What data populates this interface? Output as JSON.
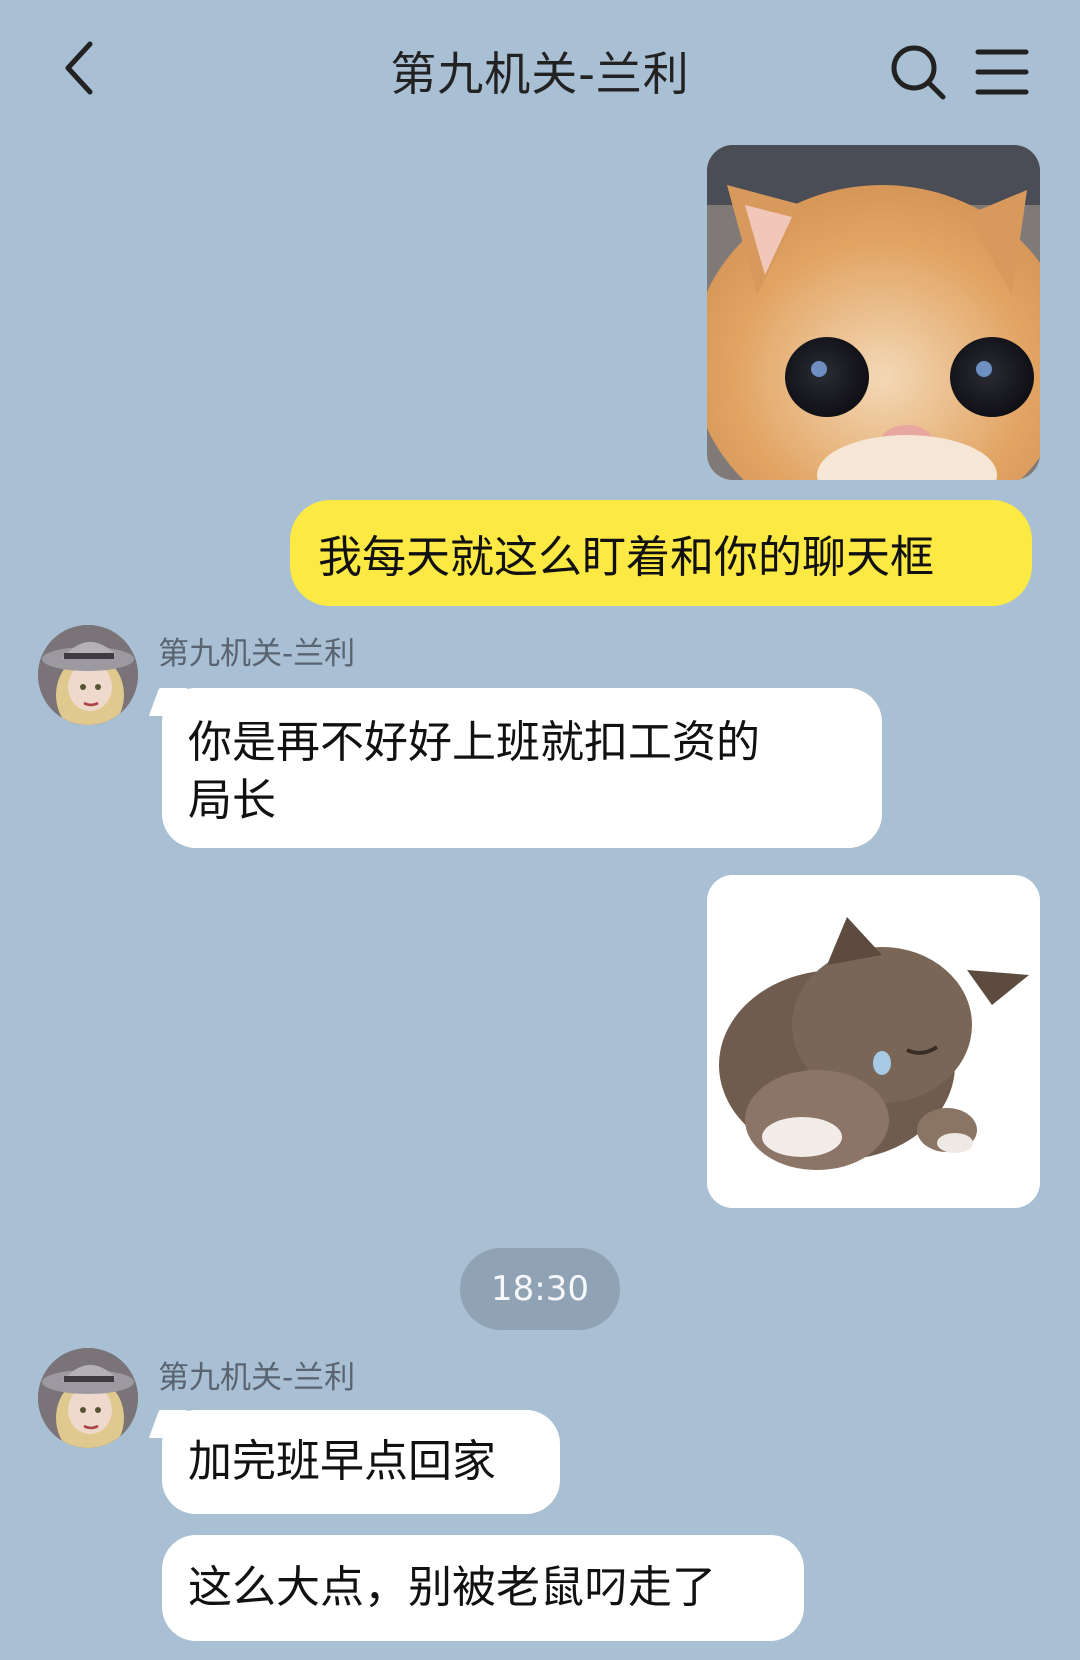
{
  "header": {
    "title": "第九机关-兰利",
    "back_icon": "chevron-left-icon",
    "search_icon": "search-icon",
    "menu_icon": "menu-icon"
  },
  "messages": [
    {
      "side": "sent",
      "type": "image",
      "icon": "kitten-sticker"
    },
    {
      "side": "sent",
      "type": "text",
      "text": "我每天就这么盯着和你的聊天框"
    },
    {
      "side": "received",
      "sender": "第九机关-兰利",
      "type": "text",
      "lines": [
        "你是再不好好上班就扣工资的",
        "局长"
      ]
    },
    {
      "side": "sent",
      "type": "image",
      "icon": "kitten-sticker"
    },
    {
      "type": "time",
      "text": "18:30"
    },
    {
      "side": "received",
      "sender": "第九机关-兰利",
      "type": "text",
      "text": "加完班早点回家"
    },
    {
      "side": "received",
      "type": "text",
      "text": "这么大点，别被老鼠叼走了"
    }
  ],
  "colors": {
    "background": "#a9bfd3",
    "sent_bubble": "#fde943",
    "received_bubble": "#ffffff",
    "time_pill": "#8fa3b5"
  }
}
